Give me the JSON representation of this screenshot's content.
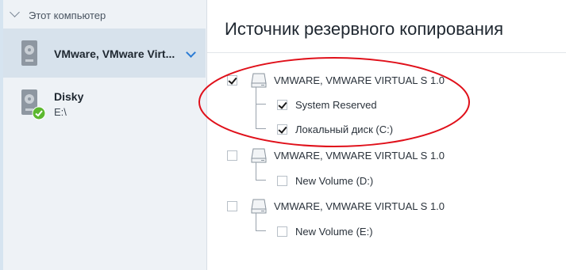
{
  "sidebar": {
    "header_label": "Этот компьютер",
    "items": [
      {
        "name": "VMware, VMware Virt...",
        "sub": ""
      },
      {
        "name": "Disky",
        "sub": "E:\\"
      }
    ]
  },
  "main": {
    "title": "Источник резервного копирования",
    "disks": [
      {
        "label": "VMWARE, VMWARE VIRTUAL S 1.0",
        "checked": true,
        "partitions": [
          {
            "label": "System Reserved",
            "checked": true
          },
          {
            "label": "Локальный диск (C:)",
            "checked": true
          }
        ]
      },
      {
        "label": "VMWARE, VMWARE VIRTUAL S 1.0",
        "checked": false,
        "partitions": [
          {
            "label": "New Volume (D:)",
            "checked": false
          }
        ]
      },
      {
        "label": "VMWARE, VMWARE VIRTUAL S 1.0",
        "checked": false,
        "partitions": [
          {
            "label": "New Volume (E:)",
            "checked": false
          }
        ]
      }
    ]
  },
  "colors": {
    "accent": "#2b7bd4",
    "annotation": "#e0101a",
    "success": "#5cb82e"
  }
}
